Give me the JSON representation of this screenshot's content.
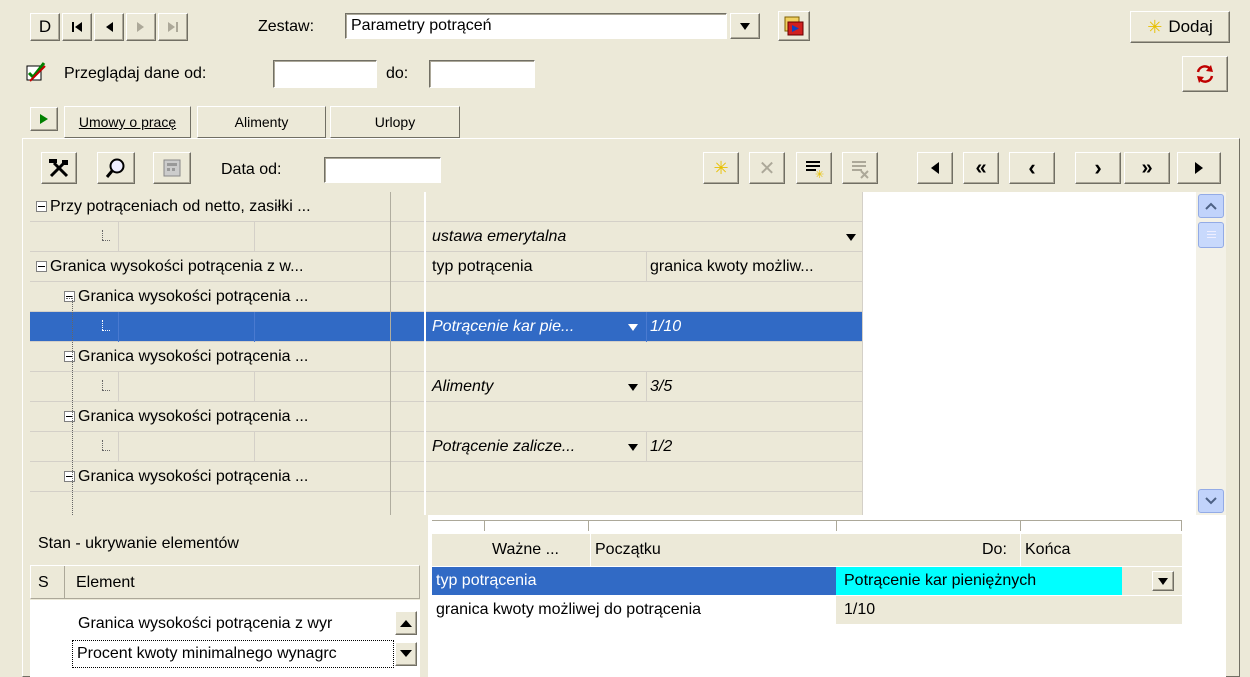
{
  "toolbar": {
    "nav_first": "D",
    "zestaw_label": "Zestaw:",
    "zestaw_value": "Parametry potrąceń",
    "add_label": "Dodaj",
    "browse_label": "Przeglądaj dane od:",
    "do_label": "do:"
  },
  "tabs": [
    "Umowy o pracę",
    "Alimenty",
    "Urlopy"
  ],
  "panel": {
    "data_od_label": "Data od:"
  },
  "tree": {
    "row1": "Przy potrąceniach od netto, zasiłki ...",
    "row2_value": "ustawa emerytalna",
    "row3": "Granica wysokości potrącenia z w...",
    "row3_col1": "typ potrącenia",
    "row3_col2": "granica kwoty możliw...",
    "row4": "Granica wysokości potrącenia ...",
    "row5_type": "Potrącenie kar pie...",
    "row5_value": "1/10",
    "row6": "Granica wysokości potrącenia ...",
    "row7_type": "Alimenty",
    "row7_value": "3/5",
    "row8": "Granica wysokości potrącenia ...",
    "row9_type": "Potrącenie zalicze...",
    "row9_value": "1/2",
    "row10": "Granica wysokości potrącenia ..."
  },
  "state": {
    "title": "Stan - ukrywanie elementów",
    "col_s": "S",
    "col_element": "Element",
    "item1": "Granica wysokości potrącenia z wyr",
    "item2": "Procent kwoty minimalnego wynagrc"
  },
  "detail": {
    "wazne_label": "Ważne ...",
    "from_value": "Początku",
    "do_label": "Do:",
    "to_value": "Końca",
    "row1_key": "typ potrącenia",
    "row1_value": "Potrącenie kar pieniężnych",
    "row2_key": "granica kwoty możliwej do potrącenia",
    "row2_value": "1/10"
  }
}
